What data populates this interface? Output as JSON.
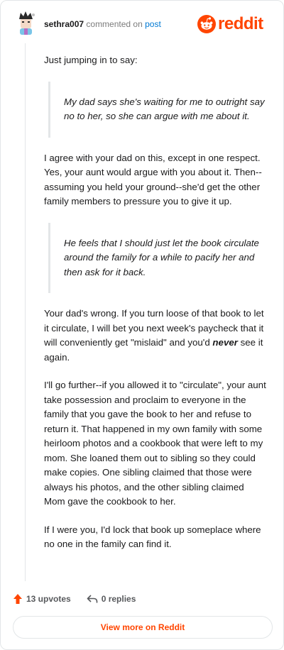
{
  "header": {
    "username": "sethra007",
    "commented_on": "commented on",
    "post_link": "post",
    "logo_text": "reddit",
    "brand_color": "#ff4500",
    "link_color": "#0079d3",
    "logo_icon": "reddit-snoo-icon"
  },
  "comment": {
    "p1": "Just jumping in to say:",
    "quote1": "My dad says she's waiting for me to outright say no to her, so she can argue with me about it.",
    "p2": "I agree with your dad on this, except in one respect. Yes, your aunt would argue with you about it. Then--assuming you held your ground--she'd get the other family members to pressure you to give it up.",
    "quote2": "He feels that I should just let the book circulate around the family for a while to pacify her and then ask for it back.",
    "p3_before": "Your dad's wrong. If you turn loose of that book to let it circulate, I will bet you next week's paycheck that it will conveniently get \"mislaid\" and you'd ",
    "p3_emph": "never",
    "p3_after": " see it again.",
    "p4": "I'll go further--if you allowed it to \"circulate\", your aunt take possession and proclaim to everyone in the family that you gave the book to her and refuse to return it. That happened in my own family with some heirloom photos and a cookbook that were left to my mom. She loaned them out to sibling so they could make copies. One sibling claimed that those were always his photos, and the other sibling claimed Mom gave the cookbook to her.",
    "p5": "If I were you, I'd lock that book up someplace where no one in the family can find it."
  },
  "footer": {
    "upvotes": "13 upvotes",
    "replies": "0 replies",
    "upvote_icon": "upvote-arrow-icon",
    "reply_icon": "reply-arrow-icon"
  },
  "view_more": "View more on Reddit"
}
